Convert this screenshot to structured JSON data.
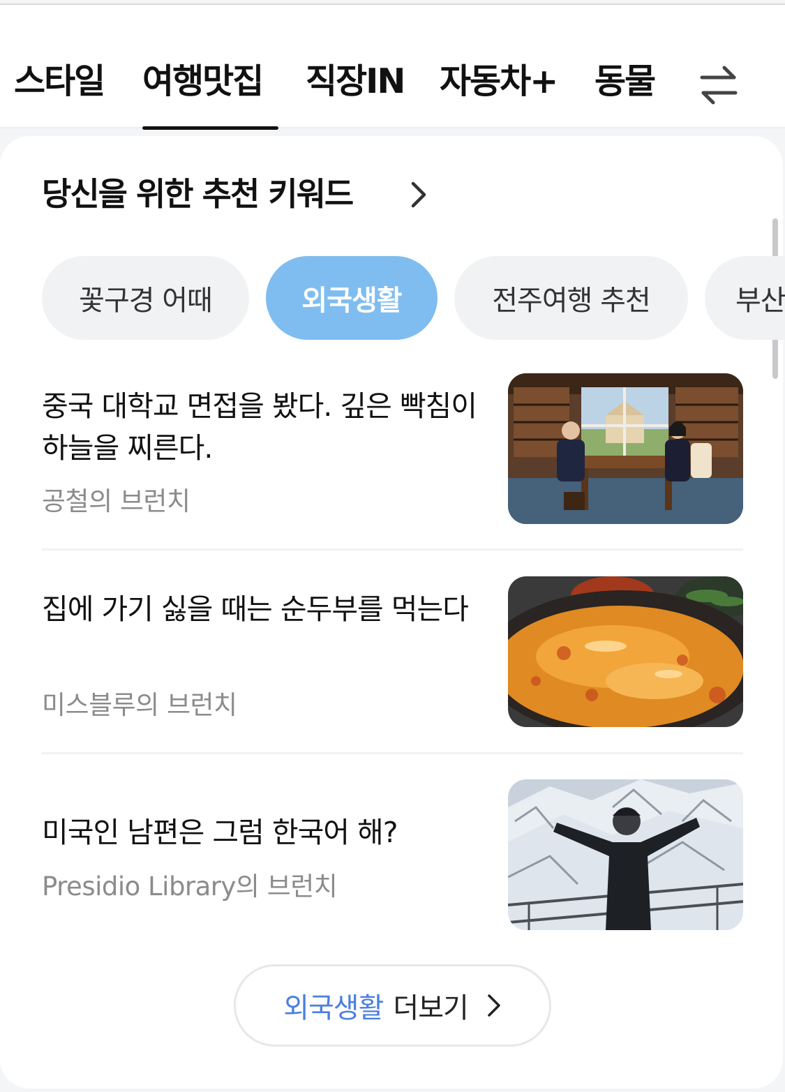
{
  "tabs": [
    {
      "label": "스타일",
      "active": false
    },
    {
      "label": "여행맛집",
      "active": true
    },
    {
      "label": "직장IN",
      "active": false
    },
    {
      "label": "자동차+",
      "active": false
    },
    {
      "label": "동물",
      "active": false
    }
  ],
  "tab_menu_icon": "swap-arrows-icon",
  "section": {
    "title": "당신을 위한 추천 키워드",
    "chevron_icon": "chevron-right-icon"
  },
  "keywords": [
    {
      "label": "꽃구경 어때",
      "active": false
    },
    {
      "label": "외국생활",
      "active": true
    },
    {
      "label": "전주여행 추천",
      "active": false
    },
    {
      "label": "부산",
      "active": false
    }
  ],
  "articles": [
    {
      "title": "중국 대학교 면접을 봤다. 깊은 빡침이 하늘을 찌른다.",
      "author": "공철의 브런치",
      "image": "interview-office-illustration"
    },
    {
      "title": "집에 가기 싫을 때는 순두부를 먹는다",
      "author": "미스블루의 브런치",
      "image": "sundubu-stew-photo"
    },
    {
      "title": "미국인 남편은 그럼 한국어 해?",
      "author": "Presidio Library의 브런치",
      "image": "snowy-mountain-man-photo"
    }
  ],
  "more_button": {
    "keyword": "외국생활",
    "label": "더보기",
    "chevron_icon": "chevron-right-icon"
  },
  "colors": {
    "active_chip": "#7fbdf0",
    "chip_bg": "#f1f2f4",
    "link_blue": "#4a7fe0",
    "author_gray": "#8b8b8b"
  }
}
